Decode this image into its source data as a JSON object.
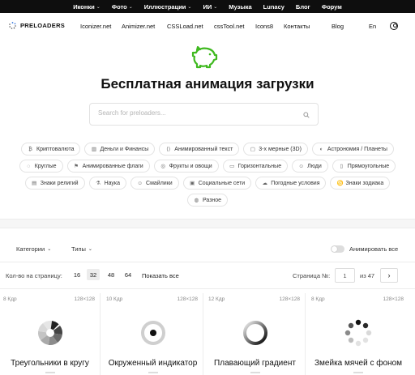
{
  "topbar": {
    "items": [
      {
        "label": "Иконки",
        "dropdown": true
      },
      {
        "label": "Фото",
        "dropdown": true
      },
      {
        "label": "Иллюстрации",
        "dropdown": true
      },
      {
        "label": "ИИ",
        "dropdown": true
      },
      {
        "label": "Музыка",
        "dropdown": false
      },
      {
        "label": "Lunacy",
        "dropdown": false
      },
      {
        "label": "Блог",
        "dropdown": false
      },
      {
        "label": "Форум",
        "dropdown": false
      }
    ]
  },
  "nav": {
    "logo": "PRELOADERS",
    "links": [
      "Iconizer.net",
      "Animizer.net",
      "CSSLoad.net",
      "cssTool.net",
      "Icons8",
      "Контакты"
    ],
    "blog": "Blog",
    "lang": "En"
  },
  "hero": {
    "title": "Бесплатная анимация загрузки",
    "icon_color": "#3fb91f"
  },
  "search": {
    "placeholder": "Search for preloaders..."
  },
  "categories": [
    [
      {
        "icon": "crypto-icon",
        "glyph": "₿",
        "label": "Криптовалюта"
      },
      {
        "icon": "money-icon",
        "glyph": "▥",
        "label": "Деньги и Финансы"
      },
      {
        "icon": "text-icon",
        "glyph": "⟨⟩",
        "label": "Анимированный текст"
      },
      {
        "icon": "cube-icon",
        "glyph": "▢",
        "label": "3-х мерные (3D)"
      },
      {
        "icon": "planet-icon",
        "glyph": "◐",
        "label": "Астрономия / Планеты"
      }
    ],
    [
      {
        "icon": "circle-dashed-icon",
        "glyph": "◌",
        "label": "Круглые"
      },
      {
        "icon": "flag-icon",
        "glyph": "⚑",
        "label": "Анимированные флаги"
      },
      {
        "icon": "fruit-icon",
        "glyph": "◎",
        "label": "Фрукты и овощи"
      },
      {
        "icon": "horizontal-icon",
        "glyph": "▭",
        "label": "Горизонтальные"
      },
      {
        "icon": "people-icon",
        "glyph": "☺",
        "label": "Люди"
      },
      {
        "icon": "rectangle-icon",
        "glyph": "▯",
        "label": "Прямоугольные"
      }
    ],
    [
      {
        "icon": "religion-icon",
        "glyph": "▤",
        "label": "Знаки религий"
      },
      {
        "icon": "science-icon",
        "glyph": "⚗",
        "label": "Наука"
      },
      {
        "icon": "smiley-icon",
        "glyph": "☺",
        "label": "Смайлики"
      },
      {
        "icon": "social-icon",
        "glyph": "▣",
        "label": "Социальные сети"
      },
      {
        "icon": "weather-icon",
        "glyph": "☁",
        "label": "Погодные условия"
      },
      {
        "icon": "zodiac-icon",
        "glyph": "♋",
        "label": "Знаки зодиака"
      }
    ],
    [
      {
        "icon": "misc-icon",
        "glyph": "◍",
        "label": "Разное"
      }
    ]
  ],
  "filters": {
    "categories_label": "Категории",
    "types_label": "Типы",
    "animate_all_label": "Анимировать все",
    "animate_all_on": false
  },
  "paging": {
    "per_page_label": "Кол-во на страницу:",
    "options": [
      "16",
      "32",
      "48",
      "64"
    ],
    "selected": "32",
    "show_all": "Показать все",
    "page_label": "Страница №:",
    "page_value": "1",
    "of_label": "из 47",
    "next_glyph": "›"
  },
  "cards": [
    {
      "frames": "8 Кдр",
      "size": "128×128",
      "title": "Треугольники в кругу",
      "anim": "triangles"
    },
    {
      "frames": "10 Кдр",
      "size": "128×128",
      "title": "Окруженный индикатор",
      "anim": "ring-dot"
    },
    {
      "frames": "12 Кдр",
      "size": "128×128",
      "title": "Плавающий градиент",
      "anim": "gradient-ring"
    },
    {
      "frames": "8 Кдр",
      "size": "128×128",
      "title": "Змейка мячей с фоном",
      "anim": "dots"
    }
  ]
}
